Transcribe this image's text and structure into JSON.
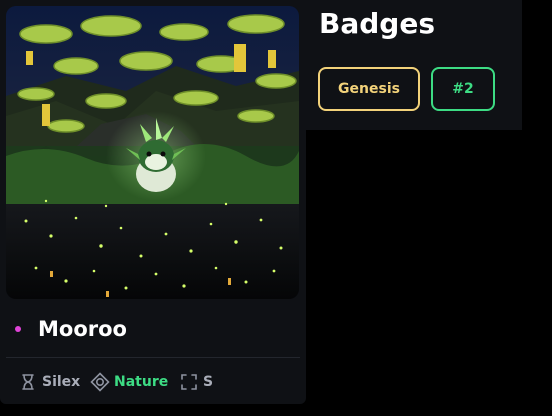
{
  "card": {
    "artwork": {
      "icon": "creature-artwork"
    },
    "name": "Mooroo",
    "name_dot_color": "#e044d8",
    "traits": [
      {
        "icon": "hourglass-icon",
        "label": "Silex",
        "color": "#a9adb8"
      },
      {
        "icon": "diamond-target-icon",
        "label": "Nature",
        "color": "#3ddc84"
      },
      {
        "icon": "size-frame-icon",
        "label": "S",
        "color": "#a9adb8"
      }
    ]
  },
  "badges": {
    "title": "Badges",
    "items": [
      {
        "label": "Genesis",
        "color": "#f2d27a"
      },
      {
        "label": "#2",
        "color": "#3ddc84"
      }
    ]
  }
}
